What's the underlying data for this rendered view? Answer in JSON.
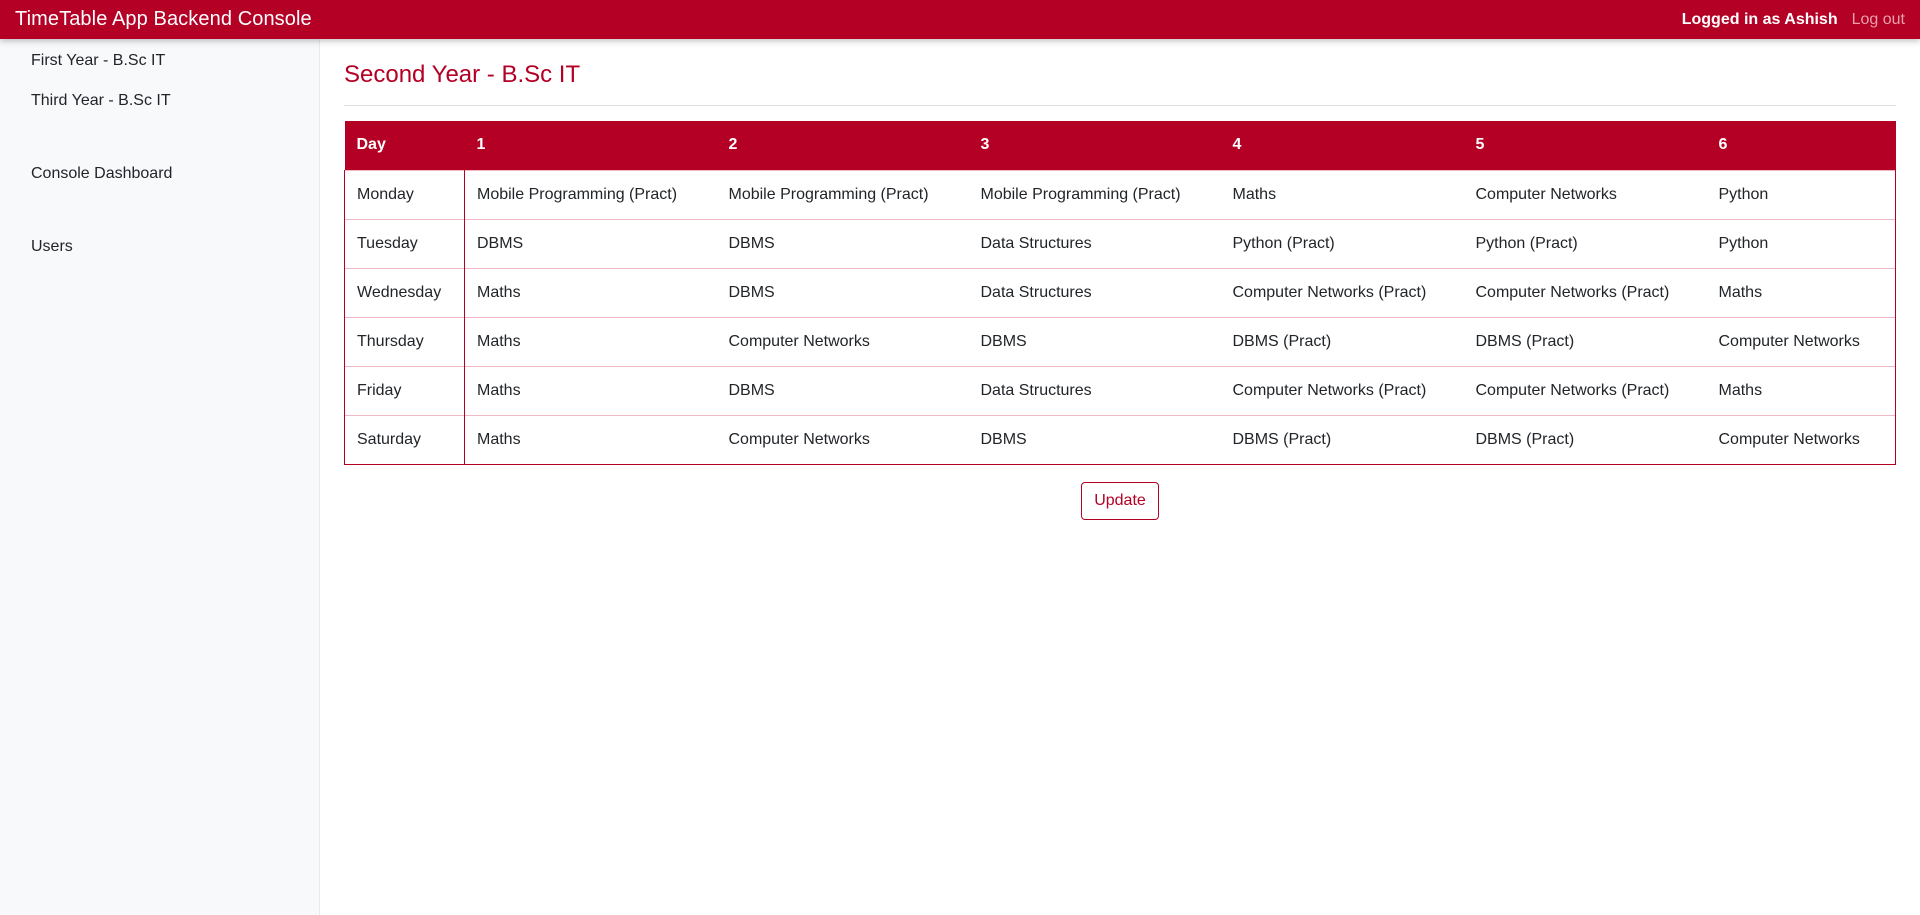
{
  "header": {
    "brand": "TimeTable App Backend Console",
    "logged_in_text": "Logged in as Ashish",
    "logout_label": "Log out"
  },
  "sidebar": {
    "items": [
      {
        "label": "First Year - B.Sc IT"
      },
      {
        "label": "Third Year - B.Sc IT"
      },
      {
        "label": "Console Dashboard"
      },
      {
        "label": "Users"
      }
    ]
  },
  "main": {
    "title": "Second Year - B.Sc IT",
    "table": {
      "headers": [
        "Day",
        "1",
        "2",
        "3",
        "4",
        "5",
        "6"
      ],
      "rows": [
        [
          "Monday",
          "Mobile Programming (Pract)",
          "Mobile Programming (Pract)",
          "Mobile Programming (Pract)",
          "Maths",
          "Computer Networks",
          "Python"
        ],
        [
          "Tuesday",
          "DBMS",
          "DBMS",
          "Data Structures",
          "Python (Pract)",
          "Python (Pract)",
          "Python"
        ],
        [
          "Wednesday",
          "Maths",
          "DBMS",
          "Data Structures",
          "Computer Networks (Pract)",
          "Computer Networks (Pract)",
          "Maths"
        ],
        [
          "Thursday",
          "Maths",
          "Computer Networks",
          "DBMS",
          "DBMS (Pract)",
          "DBMS (Pract)",
          "Computer Networks"
        ],
        [
          "Friday",
          "Maths",
          "DBMS",
          "Data Structures",
          "Computer Networks (Pract)",
          "Computer Networks (Pract)",
          "Maths"
        ],
        [
          "Saturday",
          "Maths",
          "Computer Networks",
          "DBMS",
          "DBMS (Pract)",
          "DBMS (Pract)",
          "Computer Networks"
        ]
      ]
    },
    "update_label": "Update"
  },
  "colors": {
    "accent": "#b30024",
    "sidebar_bg": "#f8f9fb"
  }
}
